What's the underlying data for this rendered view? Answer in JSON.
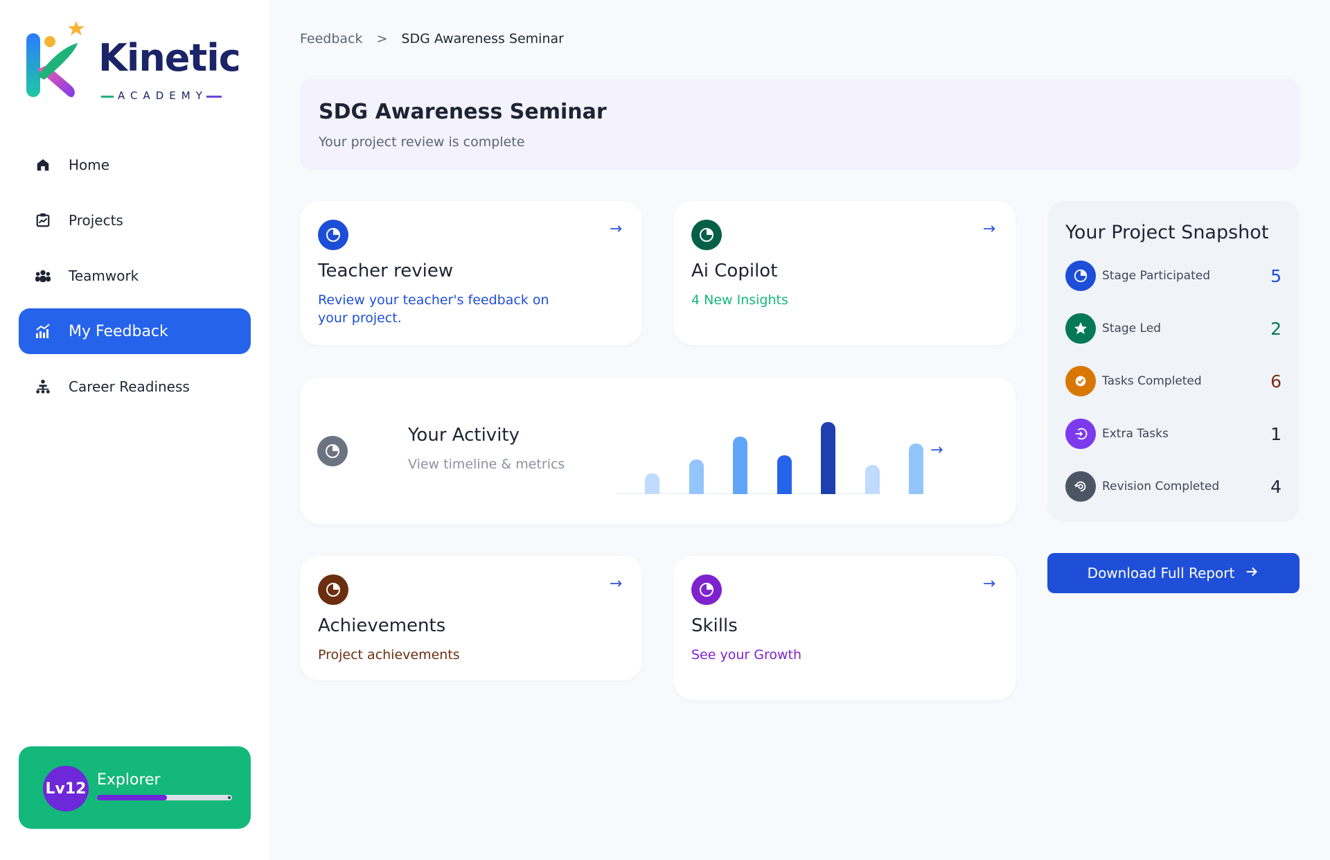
{
  "brand": {
    "name": "Kinetic",
    "subtitle": "ACADEMY"
  },
  "nav": {
    "items": [
      {
        "label": "Home",
        "icon": "home-icon"
      },
      {
        "label": "Projects",
        "icon": "projects-icon"
      },
      {
        "label": "Teamwork",
        "icon": "team-icon"
      },
      {
        "label": "My Feedback",
        "icon": "chart-icon",
        "active": true
      },
      {
        "label": "Career Readiness",
        "icon": "hierarchy-icon"
      }
    ]
  },
  "level": {
    "badge": "Lv12",
    "title": "Explorer",
    "progress": 0.56
  },
  "breadcrumb": {
    "parent": "Feedback",
    "separator": ">",
    "current": "SDG Awareness Seminar"
  },
  "header": {
    "title": "SDG Awareness Seminar",
    "subtitle": "Your project review is complete"
  },
  "cards": {
    "teacher": {
      "title": "Teacher review",
      "subtitle": "Review your teacher's feedback on your project.",
      "color": "#1d4ed8"
    },
    "copilot": {
      "title": "Ai Copilot",
      "subtitle": "4 New Insights",
      "color": "#14b87a"
    },
    "activity": {
      "title": "Your Activity",
      "subtitle": "View timeline & metrics"
    },
    "achievements": {
      "title": "Achievements",
      "subtitle": "Project achievements",
      "color": "#6b2e0f"
    },
    "skills": {
      "title": "Skills",
      "subtitle": "See your Growth",
      "color": "#7e22ce"
    }
  },
  "activity_chart": {
    "type": "bar",
    "values": [
      30,
      50,
      82,
      55,
      103,
      42,
      72
    ],
    "colors": [
      "#bfdbfe",
      "#93c5fd",
      "#60a5fa",
      "#2563eb",
      "#1e40af",
      "#bfdbfe",
      "#93c5fd"
    ]
  },
  "snapshot": {
    "title": "Your Project Snapshot",
    "items": [
      {
        "label": "Stage Participated",
        "value": "5",
        "color": "#1d4ed8",
        "icon": "pie-icon"
      },
      {
        "label": "Stage Led",
        "value": "2",
        "color": "#047857",
        "icon": "star-icon"
      },
      {
        "label": "Tasks Completed",
        "value": "6",
        "color": "#d97706",
        "icon": "check-icon"
      },
      {
        "label": "Extra Tasks",
        "value": "1",
        "color": "#7c3aed",
        "icon": "login-icon"
      },
      {
        "label": "Revision Completed",
        "value": "4",
        "color": "#4b5563",
        "icon": "revision-icon"
      }
    ]
  },
  "download": {
    "label": "Download Full Report"
  }
}
